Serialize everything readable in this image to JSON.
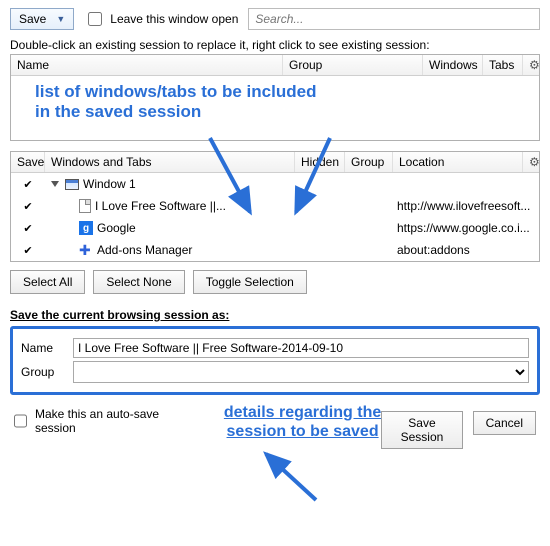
{
  "top": {
    "save_label": "Save",
    "leave_open_label": "Leave this window open",
    "search_placeholder": "Search..."
  },
  "sessions": {
    "hint": "Double-click an existing session to replace it, right click to see existing session:",
    "header": {
      "name": "Name",
      "group": "Group",
      "windows": "Windows",
      "tabs": "Tabs",
      "picker": "⚙"
    }
  },
  "annotation_list": "list of windows/tabs to be included\nin the saved session",
  "details": {
    "header": {
      "save": "Save",
      "wt": "Windows and Tabs",
      "hidden": "Hidden",
      "group": "Group",
      "location": "Location",
      "picker": "⚙"
    },
    "rows": [
      {
        "checked": true,
        "indent": 0,
        "icon": "window",
        "label": "Window 1",
        "location": ""
      },
      {
        "checked": true,
        "indent": 1,
        "icon": "page",
        "label": "I Love Free Software ||...",
        "location": "http://www.ilovefreesoft..."
      },
      {
        "checked": true,
        "indent": 1,
        "icon": "google",
        "label": "Google",
        "location": "https://www.google.co.i..."
      },
      {
        "checked": true,
        "indent": 1,
        "icon": "puzzle",
        "label": "Add-ons Manager",
        "location": "about:addons"
      }
    ]
  },
  "buttons": {
    "select_all": "Select All",
    "select_none": "Select None",
    "toggle": "Toggle Selection"
  },
  "saveas": {
    "title": "Save the current browsing session as:",
    "name_label": "Name",
    "name_value": "I Love Free Software || Free Software-2014-09-10",
    "group_label": "Group",
    "group_value": ""
  },
  "autosave_label": "Make this an auto-save session",
  "annotation_details": "details regarding the\nsession to be saved",
  "footer": {
    "save": "Save Session",
    "cancel": "Cancel"
  }
}
